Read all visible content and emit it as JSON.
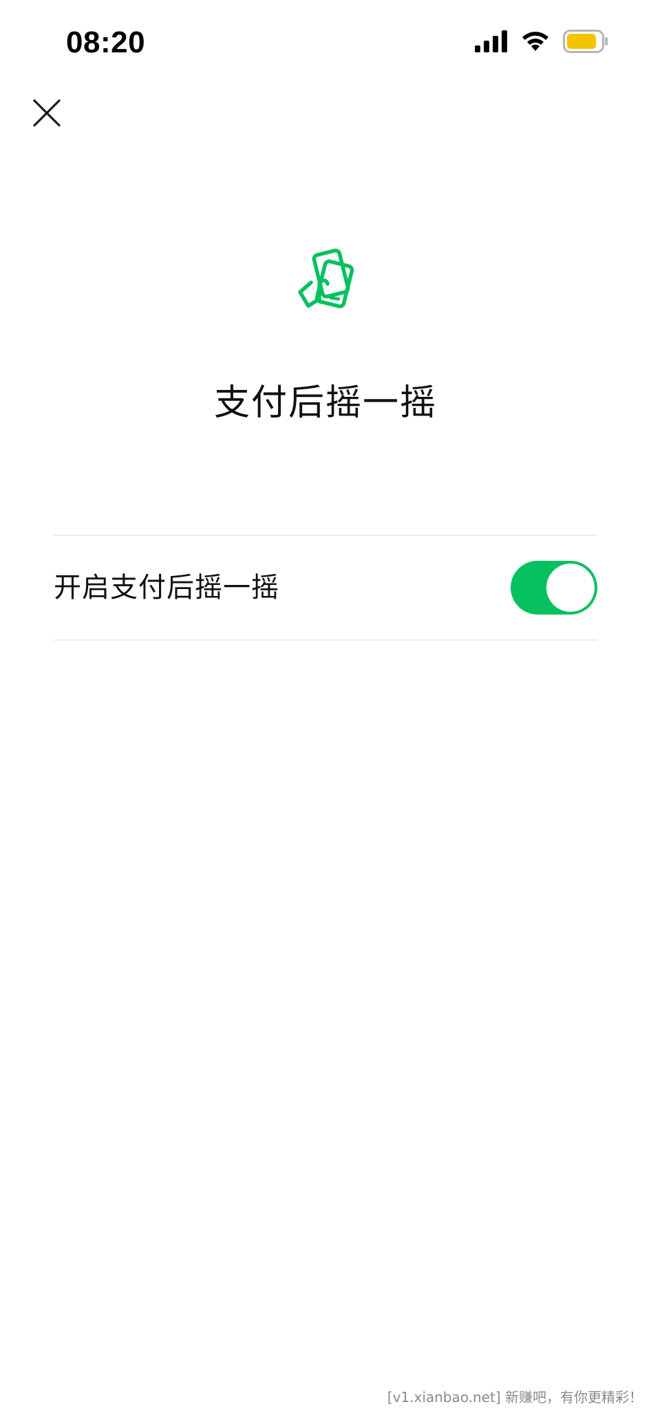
{
  "status_bar": {
    "time": "08:20",
    "icons": [
      "cellular-signal-icon",
      "wifi-icon",
      "battery-icon"
    ],
    "battery_color": "#f5c400"
  },
  "header": {
    "close_icon": "close-icon"
  },
  "hero": {
    "icon": "shake-phone-icon",
    "icon_color": "#07c160",
    "title": "支付后摇一摇"
  },
  "settings": {
    "items": [
      {
        "label": "开启支付后摇一摇",
        "toggle_on": true,
        "toggle_color": "#07c160"
      }
    ]
  },
  "watermark": {
    "text": "[v1.xianbao.net] 新赚吧，有你更精彩！"
  }
}
